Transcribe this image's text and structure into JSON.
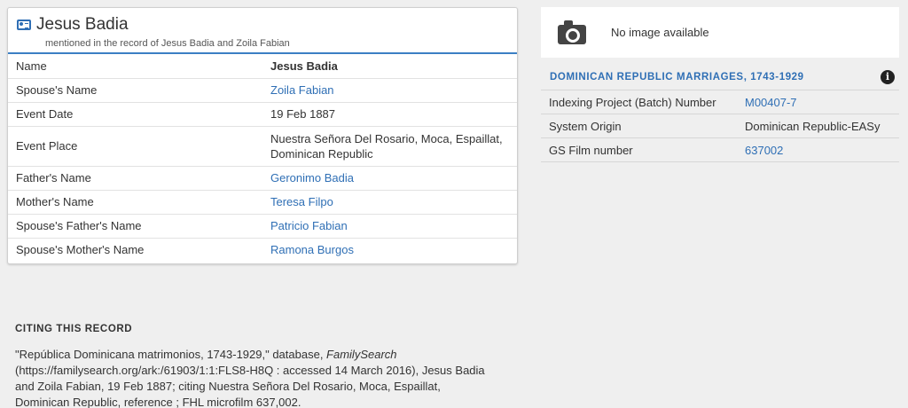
{
  "record": {
    "name": "Jesus Badia",
    "mention": "mentioned in the record of Jesus Badia and Zoila Fabian",
    "rows": [
      {
        "label": "Name",
        "value": "Jesus Badia"
      },
      {
        "label": "Spouse's Name",
        "value": "Zoila Fabian"
      },
      {
        "label": "Event Date",
        "value": "19 Feb 1887"
      },
      {
        "label": "Event Place",
        "value": "Nuestra Señora Del Rosario, Moca, Espaillat, Dominican Republic"
      },
      {
        "label": "Father's Name",
        "value": "Geronimo Badia"
      },
      {
        "label": "Mother's Name",
        "value": "Teresa Filpo"
      },
      {
        "label": "Spouse's Father's Name",
        "value": "Patricio Fabian"
      },
      {
        "label": "Spouse's Mother's Name",
        "value": "Ramona Burgos"
      }
    ]
  },
  "image_panel": {
    "text": "No image available"
  },
  "collection": {
    "title": "DOMINICAN REPUBLIC MARRIAGES, 1743-1929",
    "info_icon": "i",
    "rows": [
      {
        "label": "Indexing Project (Batch) Number",
        "value": "M00407-7"
      },
      {
        "label": "System Origin",
        "value": "Dominican Republic-EASy"
      },
      {
        "label": "GS Film number",
        "value": "637002"
      }
    ]
  },
  "citing": {
    "title": "CITING THIS RECORD",
    "text_before": "\"República Dominicana matrimonios, 1743-1929,\" database, ",
    "italic": "FamilySearch",
    "text_after": " (https://familysearch.org/ark:/61903/1:1:FLS8-H8Q : accessed 14 March 2016), Jesus Badia and Zoila Fabian, 19 Feb 1887; citing Nuestra Señora Del Rosario, Moca, Espaillat, Dominican Republic, reference ; FHL microfilm 637,002."
  },
  "colors": {
    "link": "#2f6fb5",
    "accent_border": "#3b7fc4",
    "background": "#efefef"
  }
}
